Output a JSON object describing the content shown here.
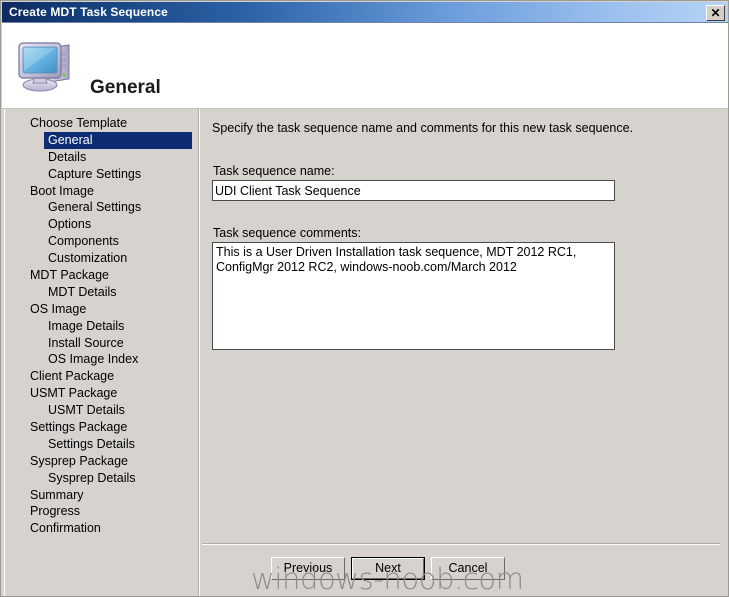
{
  "window": {
    "title": "Create MDT Task Sequence",
    "close_label": "✕"
  },
  "header": {
    "title": "General",
    "icon": "computer-icon"
  },
  "sidebar": {
    "items": [
      {
        "label": "Choose Template",
        "level": "top",
        "selected": false
      },
      {
        "label": "General",
        "level": "sub",
        "selected": true
      },
      {
        "label": "Details",
        "level": "sub",
        "selected": false
      },
      {
        "label": "Capture Settings",
        "level": "sub",
        "selected": false
      },
      {
        "label": "Boot Image",
        "level": "top",
        "selected": false
      },
      {
        "label": "General Settings",
        "level": "sub",
        "selected": false
      },
      {
        "label": "Options",
        "level": "sub",
        "selected": false
      },
      {
        "label": "Components",
        "level": "sub",
        "selected": false
      },
      {
        "label": "Customization",
        "level": "sub",
        "selected": false
      },
      {
        "label": "MDT Package",
        "level": "top",
        "selected": false
      },
      {
        "label": "MDT Details",
        "level": "sub",
        "selected": false
      },
      {
        "label": "OS Image",
        "level": "top",
        "selected": false
      },
      {
        "label": "Image Details",
        "level": "sub",
        "selected": false
      },
      {
        "label": "Install Source",
        "level": "sub",
        "selected": false
      },
      {
        "label": "OS Image Index",
        "level": "sub",
        "selected": false
      },
      {
        "label": "Client Package",
        "level": "top",
        "selected": false
      },
      {
        "label": "USMT Package",
        "level": "top",
        "selected": false
      },
      {
        "label": "USMT Details",
        "level": "sub",
        "selected": false
      },
      {
        "label": "Settings Package",
        "level": "top",
        "selected": false
      },
      {
        "label": "Settings Details",
        "level": "sub",
        "selected": false
      },
      {
        "label": "Sysprep Package",
        "level": "top",
        "selected": false
      },
      {
        "label": "Sysprep Details",
        "level": "sub",
        "selected": false
      },
      {
        "label": "Summary",
        "level": "top",
        "selected": false
      },
      {
        "label": "Progress",
        "level": "top",
        "selected": false
      },
      {
        "label": "Confirmation",
        "level": "top",
        "selected": false
      }
    ]
  },
  "main": {
    "instruction": "Specify the task sequence name and comments for this new task sequence.",
    "name_label": "Task sequence name:",
    "name_value": "UDI Client Task Sequence",
    "comments_label": "Task sequence comments:",
    "comments_value": "This is a User Driven Installation task sequence, MDT 2012 RC1, ConfigMgr 2012 RC2, windows-noob.com/March 2012"
  },
  "footer": {
    "previous_label": "Previous",
    "next_label": "Next",
    "cancel_label": "Cancel"
  },
  "watermark": {
    "text": "windows-noob.com"
  },
  "colors": {
    "titlebar_dark": "#0d2a5e",
    "titlebar_light": "#b6d3f5",
    "panel_bg": "#d6d3ce",
    "selection": "#0c2d74",
    "header_bg": "#ffffff",
    "watermark": "#8d8d8a"
  }
}
